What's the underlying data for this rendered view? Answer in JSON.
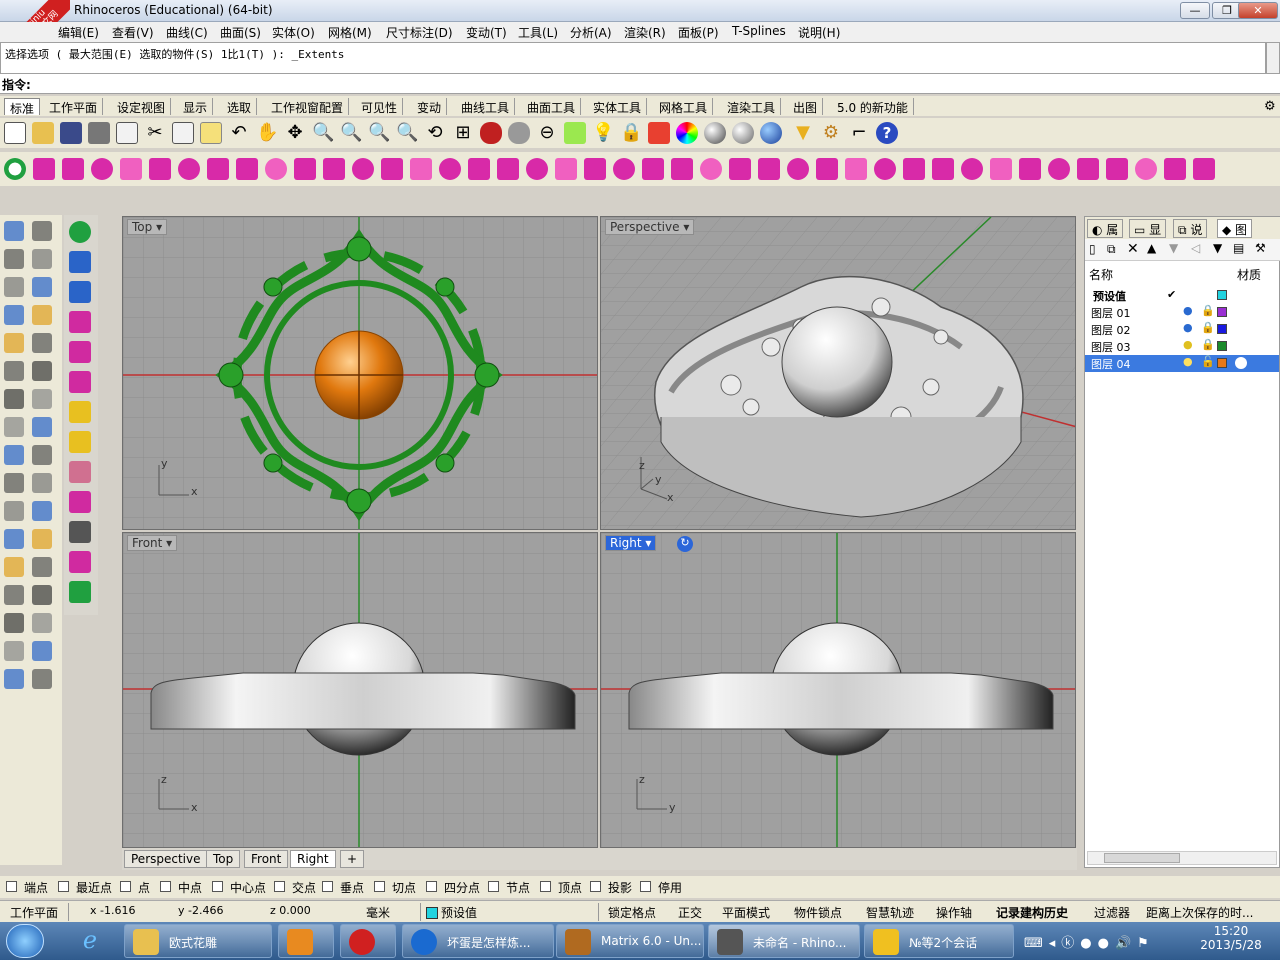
{
  "window": {
    "title": "Rhinoceros (Educational) (64-bit)",
    "logo_text": "xuexiniu 学犀牛中文网"
  },
  "menu": [
    "编辑(E)",
    "查看(V)",
    "曲线(C)",
    "曲面(S)",
    "实体(O)",
    "网格(M)",
    "尺寸标注(D)",
    "变动(T)",
    "工具(L)",
    "分析(A)",
    "渲染(R)",
    "面板(P)",
    "T-Splines",
    "说明(H)"
  ],
  "command": {
    "history": "选择选项 ( 最大范围(E) 选取的物件(S) 1比1(T) ): _Extents",
    "prompt": "指令:"
  },
  "toolbar_tabs": [
    "标准",
    "工作平面",
    "设定视图",
    "显示",
    "选取",
    "工作视窗配置",
    "可见性",
    "变动",
    "曲线工具",
    "曲面工具",
    "实体工具",
    "网格工具",
    "渲染工具",
    "出图",
    "5.0 的新功能"
  ],
  "active_toolbar_tab": "标准",
  "viewports": [
    {
      "name": "Top",
      "axis1": "y",
      "axis2": "x"
    },
    {
      "name": "Perspective",
      "axis1": "z",
      "axis2": "y",
      "axis3": "x"
    },
    {
      "name": "Front",
      "axis1": "z",
      "axis2": "x"
    },
    {
      "name": "Right",
      "axis1": "z",
      "axis2": "y",
      "active": true
    }
  ],
  "view_tabs": [
    "Perspective",
    "Top",
    "Front",
    "Right"
  ],
  "active_view_tab": "Right",
  "view_tab_add": "+",
  "panel": {
    "tabs": [
      "属",
      "显",
      "说",
      "图"
    ],
    "columns": {
      "name": "名称",
      "material": "材质"
    },
    "layers": [
      {
        "name": "预设值",
        "current": "✔",
        "color": "#22d3e0"
      },
      {
        "name": "图层 01",
        "color": "#9a2fd3"
      },
      {
        "name": "图层 02",
        "color": "#1a1ae0"
      },
      {
        "name": "图层 03",
        "color": "#1a8a2a"
      },
      {
        "name": "图层 04",
        "color": "#e87818",
        "selected": true
      }
    ]
  },
  "osnap": [
    "端点",
    "最近点",
    "点",
    "中点",
    "中心点",
    "交点",
    "垂点",
    "切点",
    "四分点",
    "节点",
    "顶点",
    "投影",
    "停用"
  ],
  "status": {
    "cplane": "工作平面",
    "x": "x -1.616",
    "y": "y -2.466",
    "z": "z 0.000",
    "unit": "毫米",
    "layer": "预设值",
    "items": [
      "锁定格点",
      "正交",
      "平面模式",
      "物件锁点",
      "智慧轨迹",
      "操作轴",
      "记录建构历史",
      "过滤器",
      "距离上次保存的时..."
    ]
  },
  "taskbar": {
    "tasks": [
      "欧式花雕",
      "",
      "",
      "坏蛋是怎样炼...",
      "Matrix 6.0 - Un...",
      "未命名 - Rhino...",
      "№等2个会话"
    ],
    "time": "15:20",
    "date": "2013/5/28"
  },
  "colors": {
    "grid": "#a0a0a0",
    "accent": "#2b66d9",
    "ornament": "#2a8a2a",
    "sphere": "#e07a10"
  }
}
